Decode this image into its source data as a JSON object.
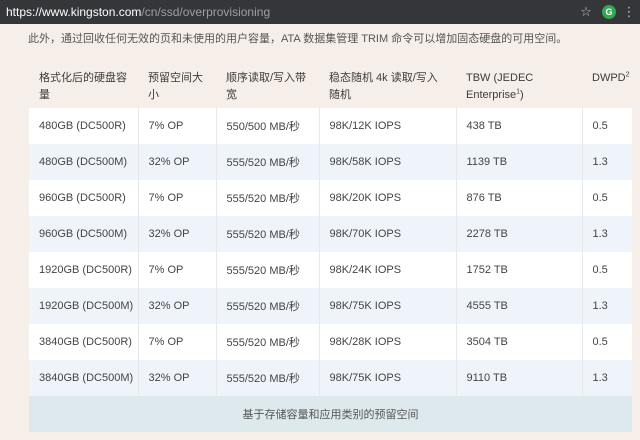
{
  "browser": {
    "url_host": "https://www.kingston.com",
    "url_path": "/cn/ssd/overprovisioning",
    "extension_letter": "G"
  },
  "intro": "此外，通过回收任何无效的页和未使用的用户容量，ATA 数据集管理 TRIM 命令可以增加固态硬盘的可用空间。",
  "table": {
    "headers": [
      {
        "text": "格式化后的硬盘容量",
        "sup": ""
      },
      {
        "text": "预留空间大小",
        "sup": ""
      },
      {
        "text": "顺序读取/写入带宽",
        "sup": ""
      },
      {
        "text": "稳态随机 4k 读取/写入随机",
        "sup": ""
      },
      {
        "text": "TBW (JEDEC Enterprise",
        "sup": "1",
        "tail": ")"
      },
      {
        "text": "DWPD",
        "sup": "2"
      }
    ],
    "rows": [
      [
        "480GB (DC500R)",
        "7% OP",
        "550/500 MB/秒",
        "98K/12K IOPS",
        "438 TB",
        "0.5"
      ],
      [
        "480GB (DC500M)",
        "32% OP",
        "555/520 MB/秒",
        "98K/58K IOPS",
        "1139 TB",
        "1.3"
      ],
      [
        "960GB (DC500R)",
        "7% OP",
        "555/520 MB/秒",
        "98K/20K IOPS",
        "876 TB",
        "0.5"
      ],
      [
        "960GB (DC500M)",
        "32% OP",
        "555/520 MB/秒",
        "98K/70K IOPS",
        "2278 TB",
        "1.3"
      ],
      [
        "1920GB (DC500R)",
        "7% OP",
        "555/520 MB/秒",
        "98K/24K IOPS",
        "1752 TB",
        "0.5"
      ],
      [
        "1920GB (DC500M)",
        "32% OP",
        "555/520 MB/秒",
        "98K/75K IOPS",
        "4555 TB",
        "1.3"
      ],
      [
        "3840GB (DC500R)",
        "7% OP",
        "555/520 MB/秒",
        "98K/28K IOPS",
        "3504 TB",
        "0.5"
      ],
      [
        "3840GB (DC500M)",
        "32% OP",
        "555/520 MB/秒",
        "98K/75K IOPS",
        "9110 TB",
        "1.3"
      ]
    ],
    "caption": "基于存储容量和应用类别的预留空间"
  }
}
